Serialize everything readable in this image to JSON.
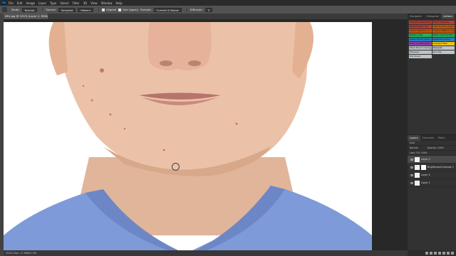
{
  "menubar": {
    "logo": "Ps",
    "items": [
      "File",
      "Edit",
      "Image",
      "Layer",
      "Type",
      "Select",
      "Filter",
      "3D",
      "View",
      "Window",
      "Help"
    ]
  },
  "options": {
    "mode_label": "Mode:",
    "mode_value": "Normal",
    "source_label": "Source:",
    "sampled": "Sampled",
    "pattern": "Pattern",
    "aligned": "Aligned",
    "use_legacy": "Use Legacy",
    "sample_label": "Sample:",
    "sample_value": "Current & Below",
    "diffusion_label": "Diffusion:",
    "diffusion_value": "5"
  },
  "document": {
    "tab_title": "IMG.jpg @ 151% (Layer 2, RGB/8) *"
  },
  "status": {
    "text": "151%  Doc: 17.0M/51.1M"
  },
  "panels": {
    "tabs": [
      "Navigator",
      "Histogram",
      "Actions"
    ],
    "actions": [
      {
        "label": "Vignette (selection)",
        "color": "#c0392b"
      },
      {
        "label": "Frame Channel",
        "color": "#c0392b"
      },
      {
        "label": "Wood Frame - 50",
        "color": "#c0392b"
      },
      {
        "label": "Cast Shadow (type)",
        "color": "#d35400"
      },
      {
        "label": "Water Reflection (t..",
        "color": "#d35400"
      },
      {
        "label": "Custom RGB to Gray",
        "color": "#d35400"
      },
      {
        "label": "Molten Lead",
        "color": "#27ae60"
      },
      {
        "label": "Make Clipping Path",
        "color": "#27ae60"
      },
      {
        "label": "Sepia Toning (layer)",
        "color": "#2980b9"
      },
      {
        "label": "Quadrant Colors",
        "color": "#2980b9"
      },
      {
        "label": "Save As Photoshop",
        "color": "#8e44ad"
      },
      {
        "label": "Gradient Map",
        "color": "#f1c40f"
      },
      {
        "label": "Mixer Brush Cloning",
        "color": "#bdc3c7"
      },
      {
        "label": "Nexsplat",
        "color": "#bdc3c7"
      },
      {
        "label": "Obsequo",
        "color": "#bdc3c7"
      },
      {
        "label": "Security",
        "color": "#bdc3c7"
      },
      {
        "label": "Full Check",
        "color": "#bdc3c7"
      }
    ],
    "layers_tabs": [
      "Layers",
      "Channels",
      "Paths"
    ],
    "kind_label": "Kind",
    "blend": "Normal",
    "opacity": "Opacity: 100%",
    "lock_fill": "Lock:   Fill: 100%",
    "layers": [
      {
        "name": "Layer 2",
        "selected": true
      },
      {
        "name": "Brightness/Contrast 1",
        "selected": false
      },
      {
        "name": "Layer 4",
        "selected": false
      },
      {
        "name": "Layer 1",
        "selected": false
      }
    ]
  }
}
